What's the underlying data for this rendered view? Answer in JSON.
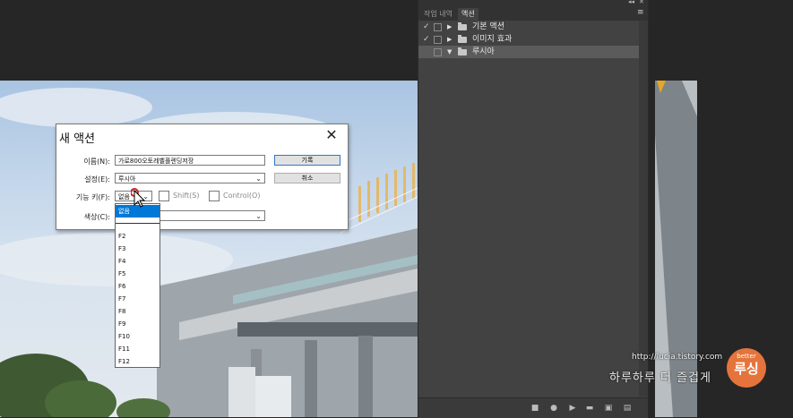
{
  "panel": {
    "collapse_glyph": "◂◂",
    "close_glyph": "✕",
    "tabs": [
      {
        "label": "작업 내역"
      },
      {
        "label": "액션"
      }
    ],
    "menu_glyph": "≡",
    "rows": [
      {
        "checked": "✓",
        "expand": "▶",
        "label": "기본 액션"
      },
      {
        "checked": "✓",
        "expand": "▶",
        "label": "이미지 효과"
      },
      {
        "checked": "",
        "expand": "▼",
        "label": "루시아"
      }
    ],
    "footer_icons": [
      "stop-icon",
      "record-icon",
      "play-icon",
      "new-set-icon",
      "new-action-icon",
      "delete-icon"
    ]
  },
  "dialog": {
    "title": "새 액션",
    "close": "✕",
    "name_label": "이름(N):",
    "name_value": "가로800오토레벨플렌딩저장",
    "set_label": "설정(E):",
    "set_value": "루시아",
    "fkey_label": "기능 키(F):",
    "fkey_value": "없음",
    "shift_label": "Shift(S)",
    "control_label": "Control(O)",
    "color_label": "색상(C):",
    "record_button": "기록",
    "cancel_button": "취소"
  },
  "dropdown": {
    "options": [
      "없음",
      "",
      "F2",
      "F3",
      "F4",
      "F5",
      "F6",
      "F7",
      "F8",
      "F9",
      "F10",
      "F11",
      "F12"
    ],
    "selected_index": 0
  },
  "watermark": {
    "url": "http://lucia.tistory.com",
    "tagline": "하루하루 더 즐겁게",
    "logo_top": "better",
    "logo_main": "루싱"
  },
  "colors": {
    "panel_bg": "#424242",
    "selection": "#0078d7",
    "logo": "#e5743c"
  }
}
